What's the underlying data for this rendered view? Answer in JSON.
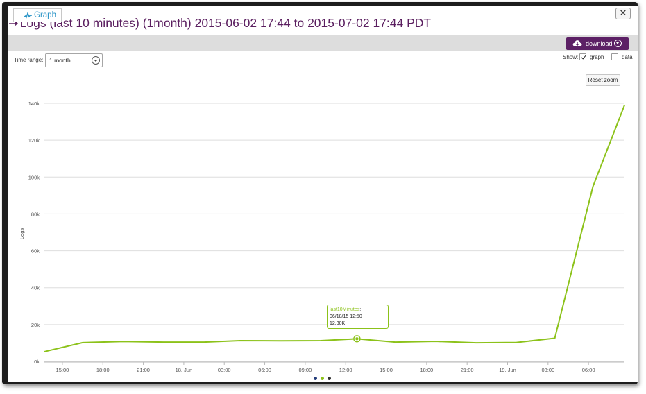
{
  "title": "Logs (last 10 minutes) (1month) 2015-06-02 17:44 to 2015-07-02 17:44 PDT",
  "title_arrow": "➝",
  "close_label": "✕",
  "tabs": [
    {
      "label": "Graph",
      "icon": "line-graph-icon"
    }
  ],
  "download_label": "download",
  "time_range": {
    "label": "Time range:",
    "selected": "1 month"
  },
  "show": {
    "label": "Show:",
    "graph_label": "graph",
    "graph_checked": true,
    "data_label": "data",
    "data_checked": false
  },
  "reset_zoom_label": "Reset zoom",
  "tooltip": {
    "series": "last10Minutes",
    "sep": ":",
    "datetime": "06/18/15 12:50",
    "value": "12.30K"
  },
  "colors": {
    "accent": "#5c2065",
    "series": "#8cc21a",
    "tab_text": "#2a94c7"
  },
  "chart_data": {
    "type": "line",
    "title": "",
    "xlabel": "",
    "ylabel": "Logs",
    "ylim": [
      0,
      140000
    ],
    "yticks": [
      "0k",
      "20k",
      "40k",
      "60k",
      "80k",
      "100k",
      "120k",
      "140k"
    ],
    "xticks": [
      "15:00",
      "18:00",
      "21:00",
      "18. Jun",
      "03:00",
      "06:00",
      "09:00",
      "12:00",
      "15:00",
      "18:00",
      "21:00",
      "19. Jun",
      "03:00",
      "06:00"
    ],
    "grid": true,
    "legend": "none",
    "series": [
      {
        "x": [
          "06/17 13:40",
          "06/17 16:30",
          "06/17 19:30",
          "06/17 22:30",
          "06/18 01:30",
          "06/18 04:10",
          "06/18 07:10",
          "06/18 10:10",
          "06/18 12:50",
          "06/18 15:40",
          "06/18 18:40",
          "06/18 21:40",
          "06/19 00:40",
          "06/19 03:30",
          "06/19 06:20",
          "06/19 08:40"
        ],
        "values": [
          5300,
          10200,
          10800,
          10500,
          10500,
          11300,
          11200,
          11300,
          12300,
          10500,
          10900,
          10100,
          10300,
          12600,
          95000,
          139000
        ]
      }
    ]
  },
  "pager_dots": [
    "#243d7a",
    "#8cc21a",
    "#333333"
  ]
}
